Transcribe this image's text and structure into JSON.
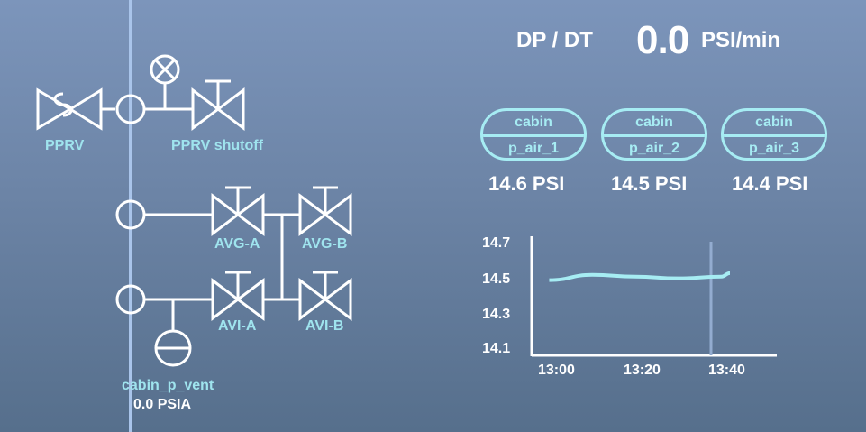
{
  "rate": {
    "label": "DP / DT",
    "value": "0.0",
    "unit": "PSI/min"
  },
  "schematic": {
    "pprv_label": "PPRV",
    "pprv_shutoff_label": "PPRV shutoff",
    "avg_a_label": "AVG-A",
    "avg_b_label": "AVG-B",
    "avi_a_label": "AVI-A",
    "avi_b_label": "AVI-B",
    "vent_label": "cabin_p_vent",
    "vent_value": "0.0 PSIA"
  },
  "sensors": [
    {
      "top": "cabin",
      "bottom": "p_air_1",
      "reading": "14.6 PSI"
    },
    {
      "top": "cabin",
      "bottom": "p_air_2",
      "reading": "14.5 PSI"
    },
    {
      "top": "cabin",
      "bottom": "p_air_3",
      "reading": "14.4 PSI"
    }
  ],
  "colors": {
    "line": "#ffffff",
    "accent": "#9fe4ee",
    "trend": "#a6ecf3"
  },
  "chart_data": {
    "type": "line",
    "x_ticks": [
      "13:00",
      "13:20",
      "13:40"
    ],
    "y_ticks": [
      "14.7",
      "14.5",
      "14.3",
      "14.1"
    ],
    "ylim": [
      14.1,
      14.7
    ],
    "series": [
      {
        "x": [
          "12:58",
          "13:08",
          "13:18",
          "13:28",
          "13:38",
          "13:40"
        ],
        "values": [
          14.49,
          14.52,
          14.51,
          14.5,
          14.51,
          14.53
        ]
      }
    ]
  }
}
